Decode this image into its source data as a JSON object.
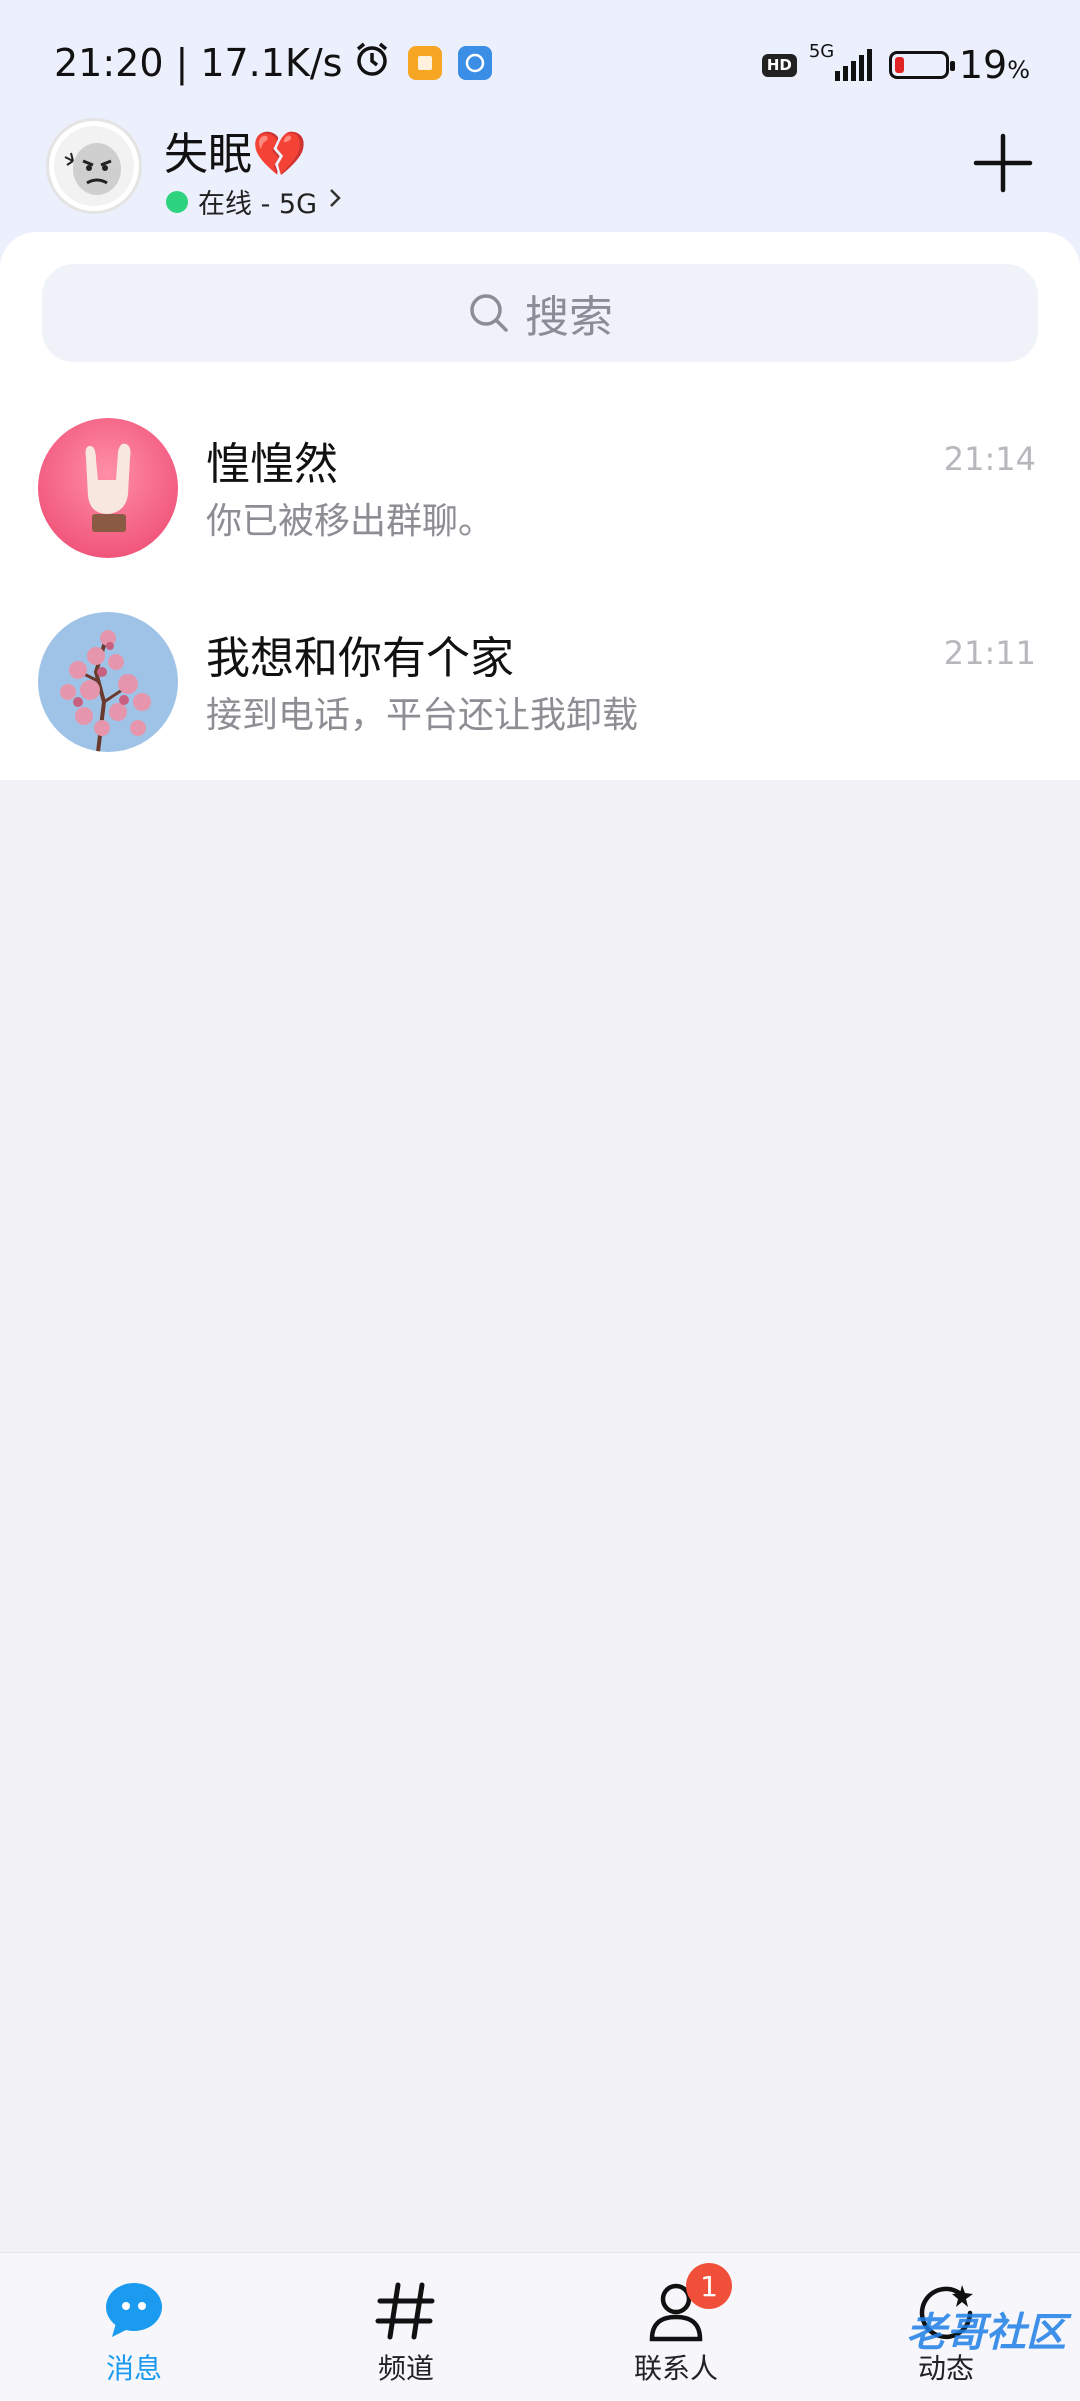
{
  "status_bar": {
    "time": "21:20",
    "separator": "|",
    "net_speed": "17.1K/s",
    "hd_label": "HD",
    "network": "5G",
    "battery_percent": "19",
    "battery_unit": "%",
    "battery_level": 0.19
  },
  "header": {
    "user_name": "失眠💔",
    "status_text": "在线 - 5G",
    "status_color": "#2dd37f"
  },
  "search": {
    "placeholder": "搜索"
  },
  "chats": [
    {
      "title": "惶惶然",
      "preview": "你已被移出群聊。",
      "time": "21:14"
    },
    {
      "title": "我想和你有个家",
      "preview": "接到电话，平台还让我卸载",
      "time": "21:11"
    }
  ],
  "bottom_nav": {
    "items": [
      {
        "label": "消息",
        "icon": "chat-bubble-icon",
        "active": true
      },
      {
        "label": "频道",
        "icon": "hash-icon"
      },
      {
        "label": "联系人",
        "icon": "contact-icon",
        "badge": "1"
      },
      {
        "label": "动态",
        "icon": "refresh-star-icon"
      }
    ]
  },
  "watermark": "老哥社区",
  "colors": {
    "accent": "#1a9bf0",
    "badge": "#f0503a",
    "header_bg": "#eceffc",
    "page_bg": "#f1f1f6"
  }
}
